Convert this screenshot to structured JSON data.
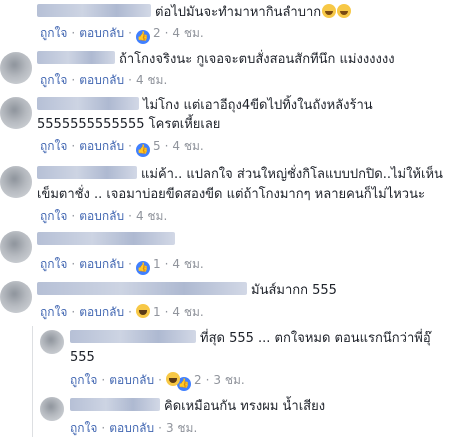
{
  "comments": [
    {
      "text": "ต่อไปมันจะทำมาหากินลำบาก",
      "like": "ถูกใจ",
      "reply": "ตอบกลับ",
      "count": "2",
      "time": "4 ชม."
    },
    {
      "text": "ถ้าโกงจริงนะ กูเจอจะตบสั่งสอนสักทีนึก แม่งงงงงง",
      "like": "ถูกใจ",
      "reply": "ตอบกลับ",
      "count": "",
      "time": "4 ชม."
    },
    {
      "text1": "ไม่โกง แต่เอาอีถุง4ขีดไปทิ้งในถังหลังร้าน",
      "text2": "5555555555555 โครตเหี้ยเลย",
      "like": "ถูกใจ",
      "reply": "ตอบกลับ",
      "count": "5",
      "time": "4 ชม."
    },
    {
      "text1": "แม่ค้า.. แปลกใจ ส่วนใหญ่ชั่งกิโลแบบปกปิด..ไม่ให้เห็น",
      "text2": "เข็มตาชั่ง .. เจอมาบ่อยขีดสองขีด แต่ถ้าโกงมากๆ หลายคนก็ไม่ไหวนะ",
      "like": "ถูกใจ",
      "reply": "ตอบกลับ",
      "count": "",
      "time": "4 ชม."
    },
    {
      "text": "",
      "like": "ถูกใจ",
      "reply": "ตอบกลับ",
      "count": "1",
      "time": "4 ชม."
    },
    {
      "text": "มันส์มากก 555",
      "like": "ถูกใจ",
      "reply": "ตอบกลับ",
      "count": "1",
      "time": "4 ชม."
    }
  ],
  "replies": [
    {
      "text1": "ที่สุด 555 ... ตกใจหมด ตอนแรกนึกว่าพี่อุ๊",
      "text2": "555",
      "like": "ถูกใจ",
      "reply": "ตอบกลับ",
      "count": "2",
      "time": "3 ชม."
    },
    {
      "text": "คิดเหมือนกัน ทรงผม น้ำเสียง",
      "like": "ถูกใจ",
      "reply": "ตอบกลับ",
      "count": "",
      "time": "3 ชม."
    }
  ],
  "colors": {
    "link": "#4267b2",
    "muted": "#90949c",
    "like": "#4080ff"
  }
}
